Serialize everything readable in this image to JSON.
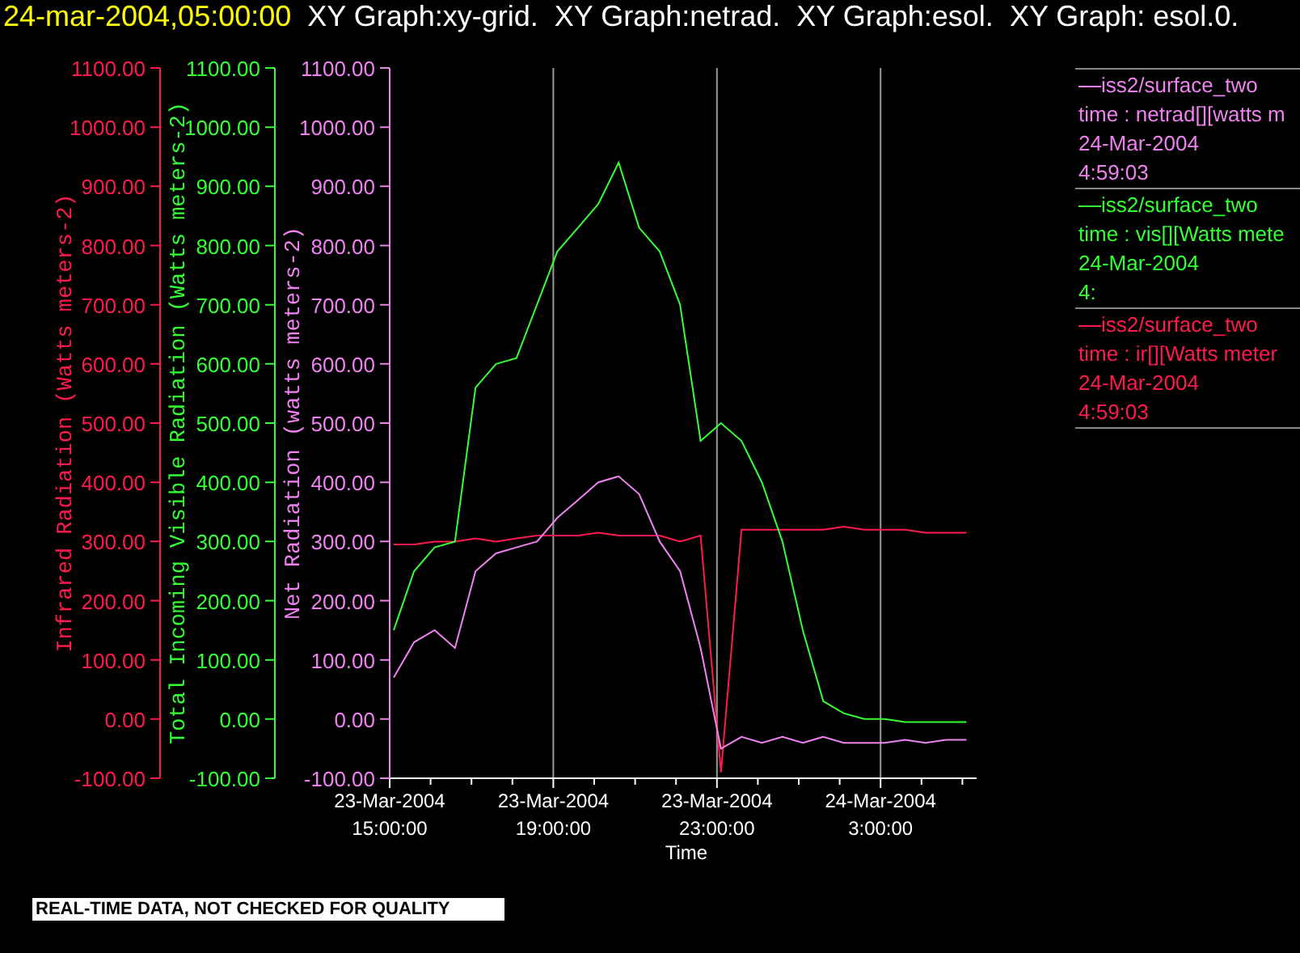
{
  "header": {
    "timestamp": "24-mar-2004,05:00:00",
    "graphs": [
      "XY Graph:xy-grid.",
      "XY Graph:netrad.",
      "XY Graph:esol.",
      "XY Graph: esol.0."
    ]
  },
  "plot": {
    "y_axes": [
      {
        "title": "Infrared Radiation (Watts meters-2)",
        "color": "#ff1a4d"
      },
      {
        "title": "Total Incoming Visible Radiation (Watts meters-2)",
        "color": "#33ff33"
      },
      {
        "title": "Net Radiation (watts meters-2)",
        "color": "#ee82ee"
      }
    ],
    "chart_data": {
      "type": "line",
      "grid": true,
      "xlabel": "Time",
      "ylim": [
        -100,
        1100
      ],
      "categories": [
        "23-Mar-2004 15:00:00",
        null,
        null,
        null,
        null,
        null,
        null,
        null,
        "23-Mar-2004 19:00:00",
        null,
        null,
        null,
        null,
        null,
        null,
        null,
        "23-Mar-2004 23:00:00",
        null,
        null,
        null,
        null,
        null,
        null,
        null,
        "24-Mar-2004 3:00:00",
        null,
        null,
        null,
        null
      ],
      "yticks": [
        {
          "value": -100,
          "label": "-100.00"
        },
        {
          "value": 0,
          "label": "0.00"
        },
        {
          "value": 100,
          "label": "100.00"
        },
        {
          "value": 200,
          "label": "200.00"
        },
        {
          "value": 300,
          "label": "300.00"
        },
        {
          "value": 400,
          "label": "400.00"
        },
        {
          "value": 500,
          "label": "500.00"
        },
        {
          "value": 600,
          "label": "600.00"
        },
        {
          "value": 700,
          "label": "700.00"
        },
        {
          "value": 800,
          "label": "800.00"
        },
        {
          "value": 900,
          "label": "900.00"
        },
        {
          "value": 1000,
          "label": "1000.00"
        },
        {
          "value": 1100,
          "label": "1100.00"
        }
      ],
      "series": [
        {
          "color": "#ff1a4d",
          "values": [
            295,
            295,
            300,
            300,
            305,
            300,
            305,
            310,
            310,
            310,
            315,
            310,
            310,
            310,
            300,
            310,
            -90,
            320,
            320,
            320,
            320,
            320,
            325,
            320,
            320,
            320,
            315,
            315,
            315
          ]
        },
        {
          "color": "#33ff33",
          "values": [
            150,
            250,
            290,
            300,
            560,
            600,
            610,
            700,
            790,
            830,
            870,
            940,
            830,
            790,
            700,
            470,
            500,
            470,
            400,
            300,
            150,
            30,
            10,
            0,
            0,
            -5,
            -5,
            -5,
            -5
          ]
        },
        {
          "color": "#ee82ee",
          "values": [
            70,
            130,
            150,
            120,
            250,
            280,
            290,
            300,
            340,
            370,
            400,
            410,
            380,
            300,
            250,
            120,
            -50,
            -30,
            -40,
            -30,
            -40,
            -30,
            -40,
            -40,
            -40,
            -35,
            -40,
            -35,
            -35
          ]
        }
      ]
    }
  },
  "legend": [
    {
      "source": "iss2/surface_two",
      "variable": "time : netrad[][watts m",
      "date": "24-Mar-2004",
      "time": "4:59:03",
      "color": "#ee82ee"
    },
    {
      "source": "iss2/surface_two",
      "variable": "time : vis[][Watts mete",
      "date": "24-Mar-2004",
      "time": "4:",
      "color": "#33ff33"
    },
    {
      "source": "iss2/surface_two",
      "variable": "time : ir[][Watts meter",
      "date": "24-Mar-2004",
      "time": "4:59:03",
      "color": "#ff1a4d"
    }
  ],
  "notice": "REAL-TIME DATA, NOT CHECKED FOR QUALITY"
}
